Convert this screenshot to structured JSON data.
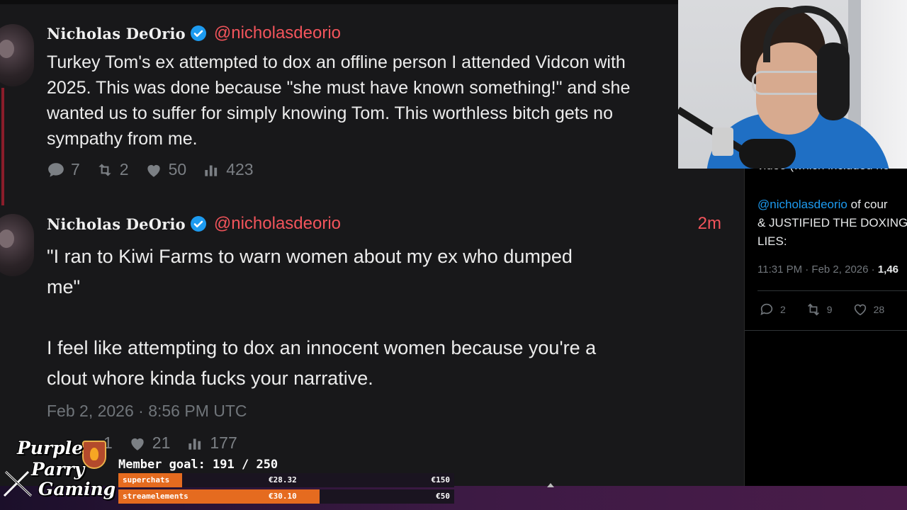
{
  "tweets": [
    {
      "name": "Nicholas DeOrio",
      "handle": "@nicholasdeorio",
      "time_ago": "",
      "text": "Turkey Tom's ex attempted to dox an offline person I attended Vidcon with\n2025. This was done because \"she must have known something!\" and she\nwanted us to suffer for simply knowing Tom. This worthless bitch gets no\nsympathy from me.",
      "stats": {
        "replies": "7",
        "retweets": "2",
        "likes": "50",
        "views": "423"
      }
    },
    {
      "name": "Nicholas DeOrio",
      "handle": "@nicholasdeorio",
      "time_ago": "2m",
      "text": "\"I ran to Kiwi Farms to warn women about my ex who dumped\nme\"\n\nI feel like attempting to dox an innocent women because you're a\nclout whore kinda fucks your narrative.",
      "date": "Feb 2, 2026 · 8:56 PM UTC",
      "stats": {
        "replies": "1",
        "likes": "21",
        "views": "177"
      }
    }
  ],
  "x_panel": {
    "cut_text": "video (which included ne",
    "reply_mention": "@nicholasdeorio",
    "reply_line1_rest": " of cour",
    "reply_line2": "& JUSTIFIED THE DOXING",
    "reply_line3": "LIES:",
    "meta_time": "11:31 PM · Feb 2, 2026 · ",
    "meta_views": "1,46",
    "replies": "2",
    "retweets": "9",
    "likes": "28"
  },
  "overlay": {
    "logo_line1": "Purple",
    "logo_line2": "Parry",
    "logo_line3": "Gaming",
    "member_goal": "Member goal: 191 / 250",
    "bars": [
      {
        "label": "superchats",
        "amount": "€28.32",
        "goal": "€150",
        "progress": 0.19,
        "color": "#e56b1f"
      },
      {
        "label": "streamelements",
        "amount": "€30.10",
        "goal": "€50",
        "progress": 0.6,
        "color": "#e56b1f"
      }
    ]
  },
  "colors": {
    "accent": "#f2545b",
    "link": "#1d9bf0",
    "verified": "#1d9bf0",
    "bar_fill": "#e56b1f"
  }
}
